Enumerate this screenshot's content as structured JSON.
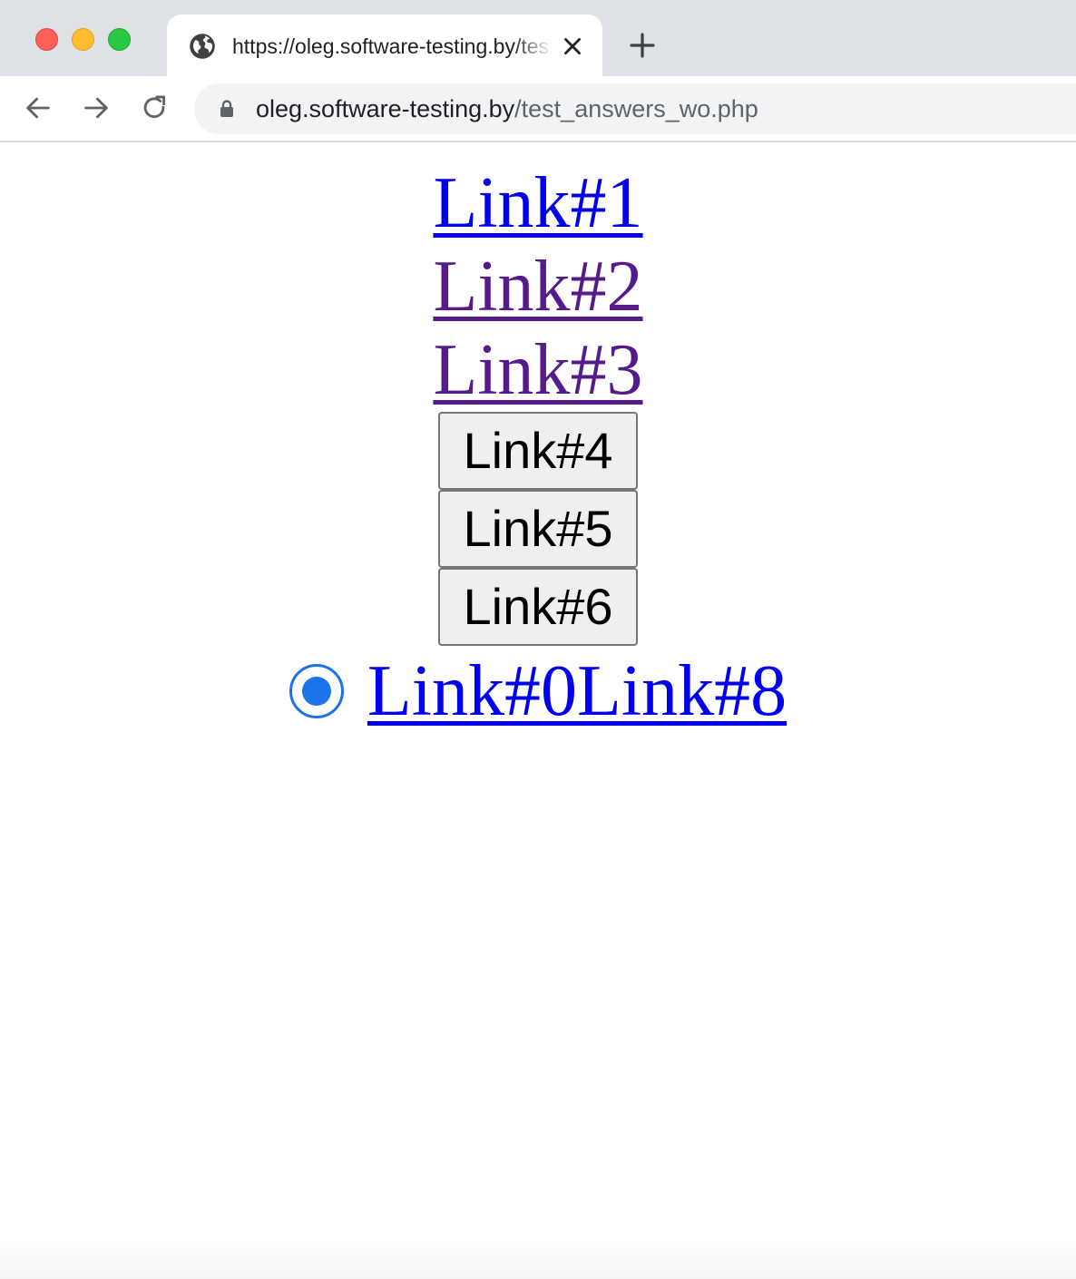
{
  "browser": {
    "tab": {
      "title": "https://oleg.software-testing.by/test_answers_wo.php",
      "icon": "globe-icon"
    },
    "address": {
      "host": "oleg.software-testing.by",
      "path": "/test_answers_wo.php"
    },
    "colors": {
      "tabstrip": "#dee1e6",
      "close": "#fe5f57",
      "minimize": "#febc2e",
      "maximize": "#28c840"
    }
  },
  "page": {
    "links": [
      {
        "label": "Link#1",
        "state": "unvisited"
      },
      {
        "label": "Link#2",
        "state": "visited"
      },
      {
        "label": "Link#3",
        "state": "visited"
      }
    ],
    "buttons": [
      {
        "label": "Link#4"
      },
      {
        "label": "Link#5"
      },
      {
        "label": "Link#6"
      }
    ],
    "radio": {
      "checked": true
    },
    "row_links": [
      {
        "label": "Link#0"
      },
      {
        "label": "Link#8"
      }
    ],
    "colors": {
      "link": "#0000ee",
      "visited": "#551a8b",
      "radio": "#1a73e8"
    }
  }
}
